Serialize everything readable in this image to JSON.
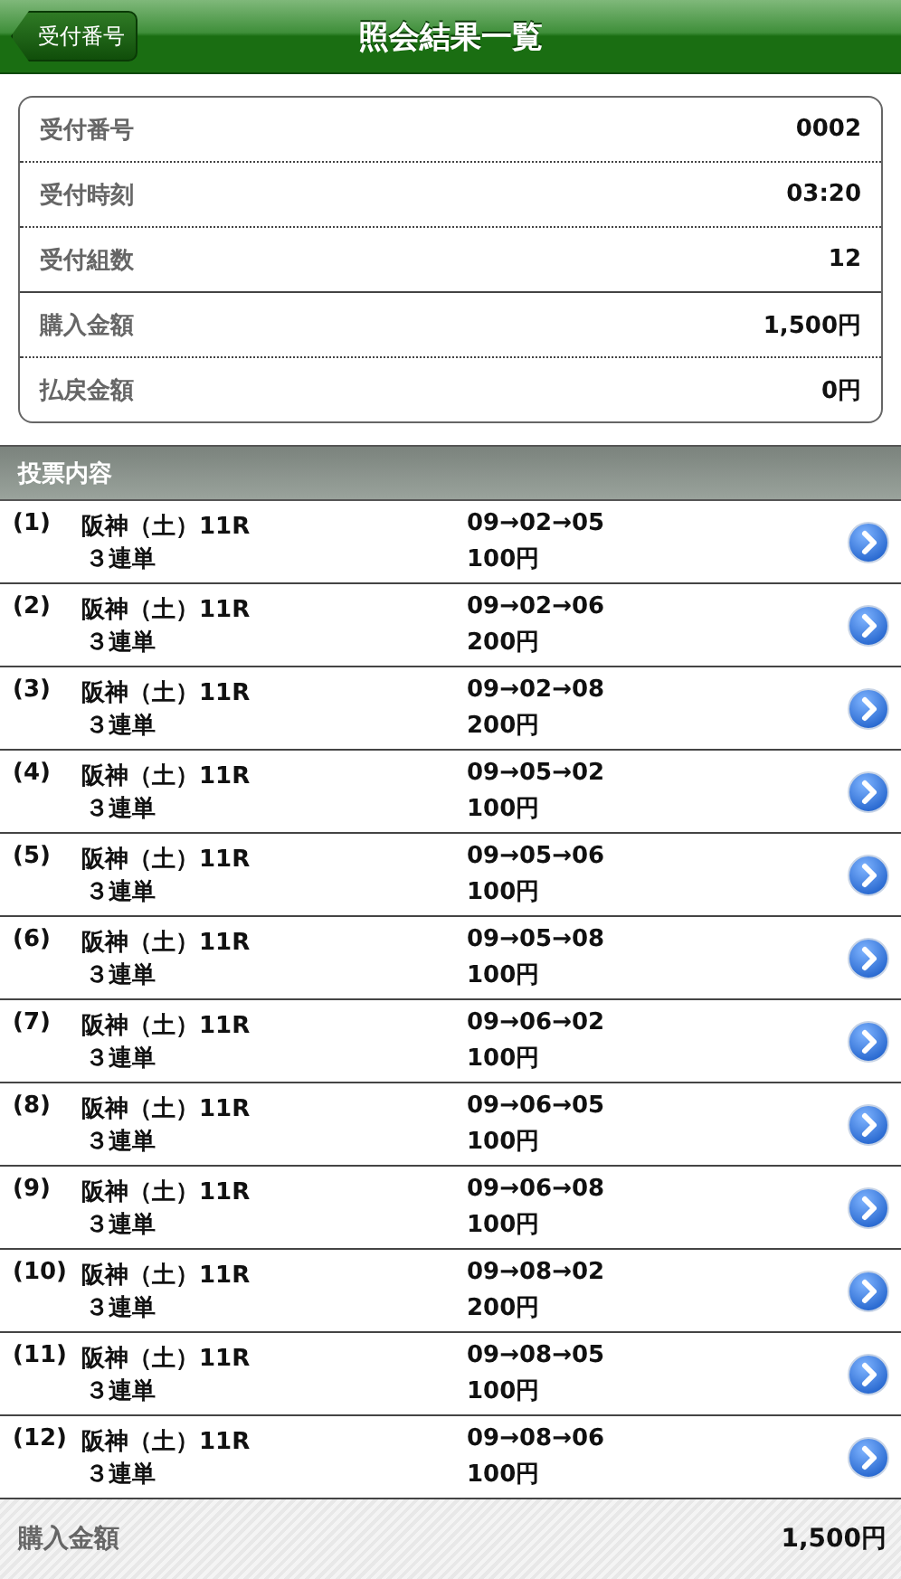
{
  "header": {
    "back_button": "受付番号",
    "title": "照会結果一覧"
  },
  "summary_groups": [
    [
      {
        "label": "受付番号",
        "value": "0002"
      },
      {
        "label": "受付時刻",
        "value": "03:20"
      },
      {
        "label": "受付組数",
        "value": "12"
      }
    ],
    [
      {
        "label": "購入金額",
        "value": "1,500円"
      },
      {
        "label": "払戻金額",
        "value": "0円"
      }
    ]
  ],
  "section_title": "投票内容",
  "bets": [
    {
      "index": "(1)",
      "race": "阪神（土）11R",
      "bet_type": "３連単",
      "combination": "09→02→05",
      "amount": "100円"
    },
    {
      "index": "(2)",
      "race": "阪神（土）11R",
      "bet_type": "３連単",
      "combination": "09→02→06",
      "amount": "200円"
    },
    {
      "index": "(3)",
      "race": "阪神（土）11R",
      "bet_type": "３連単",
      "combination": "09→02→08",
      "amount": "200円"
    },
    {
      "index": "(4)",
      "race": "阪神（土）11R",
      "bet_type": "３連単",
      "combination": "09→05→02",
      "amount": "100円"
    },
    {
      "index": "(5)",
      "race": "阪神（土）11R",
      "bet_type": "３連単",
      "combination": "09→05→06",
      "amount": "100円"
    },
    {
      "index": "(6)",
      "race": "阪神（土）11R",
      "bet_type": "３連単",
      "combination": "09→05→08",
      "amount": "100円"
    },
    {
      "index": "(7)",
      "race": "阪神（土）11R",
      "bet_type": "３連単",
      "combination": "09→06→02",
      "amount": "100円"
    },
    {
      "index": "(8)",
      "race": "阪神（土）11R",
      "bet_type": "３連単",
      "combination": "09→06→05",
      "amount": "100円"
    },
    {
      "index": "(9)",
      "race": "阪神（土）11R",
      "bet_type": "３連単",
      "combination": "09→06→08",
      "amount": "100円"
    },
    {
      "index": "(10)",
      "race": "阪神（土）11R",
      "bet_type": "３連単",
      "combination": "09→08→02",
      "amount": "200円"
    },
    {
      "index": "(11)",
      "race": "阪神（土）11R",
      "bet_type": "３連単",
      "combination": "09→08→05",
      "amount": "100円"
    },
    {
      "index": "(12)",
      "race": "阪神（土）11R",
      "bet_type": "３連単",
      "combination": "09→08→06",
      "amount": "100円"
    }
  ],
  "footer": {
    "label": "購入金額",
    "value": "1,500円"
  }
}
